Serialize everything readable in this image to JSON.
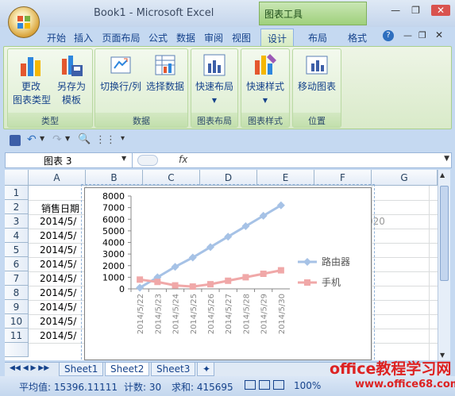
{
  "window": {
    "title": "Book1 - Microsoft Excel",
    "context_tab": "图表工具"
  },
  "tabs": [
    "开始",
    "插入",
    "页面布局",
    "公式",
    "数据",
    "审阅",
    "视图",
    "设计",
    "布局",
    "格式"
  ],
  "ribbon": {
    "groups": [
      {
        "label": "类型",
        "buttons": [
          "更改\n图表类型",
          "另存为\n模板"
        ]
      },
      {
        "label": "数据",
        "buttons": [
          "切换行/列",
          "选择数据"
        ]
      },
      {
        "label": "图表布局",
        "buttons": [
          "快速布局"
        ]
      },
      {
        "label": "图表样式",
        "buttons": [
          "快速样式"
        ]
      },
      {
        "label": "位置",
        "buttons": [
          "移动图表"
        ]
      }
    ]
  },
  "formula_bar": {
    "name_box": "图表 3",
    "fx": "fx",
    "value": ""
  },
  "columns": [
    "A",
    "B",
    "C",
    "D",
    "E",
    "F",
    "G"
  ],
  "rows": [
    "1",
    "2",
    "3",
    "4",
    "5",
    "6",
    "7",
    "8",
    "9",
    "10",
    "11"
  ],
  "cells": {
    "A2": "销售日期",
    "A3": "2014/5/",
    "A4": "2014/5/",
    "A5": "2014/5/",
    "A6": "2014/5/",
    "A7": "2014/5/",
    "A8": "2014/5/",
    "A9": "2014/5/",
    "A10": "2014/5/",
    "A11": "2014/5/",
    "F3": "020"
  },
  "chart_data": {
    "type": "line",
    "x": [
      "2014/5/22",
      "2014/5/23",
      "2014/5/24",
      "2014/5/25",
      "2014/5/26",
      "2014/5/27",
      "2014/5/28",
      "2014/5/29",
      "2014/5/30"
    ],
    "series": [
      {
        "name": "路由器",
        "values": [
          100,
          1000,
          1900,
          2700,
          3600,
          4500,
          5400,
          6300,
          7200
        ],
        "color": "#a6c2e6"
      },
      {
        "name": "手机",
        "values": [
          800,
          600,
          300,
          200,
          400,
          700,
          1000,
          1300,
          1600
        ],
        "color": "#f0a8a8"
      }
    ],
    "yticks": [
      "0",
      "1000",
      "2000",
      "3000",
      "4000",
      "5000",
      "6000",
      "7000",
      "8000"
    ],
    "ylim": [
      0,
      8000
    ]
  },
  "sheets": [
    "Sheet1",
    "Sheet2",
    "Sheet3"
  ],
  "active_sheet": "Sheet2",
  "status": {
    "average": "平均值: 15396.11111",
    "count": "计数: 30",
    "sum": "求和: 415695",
    "zoom": "100%"
  },
  "watermark": {
    "line1": "office教程学习网",
    "line2": "www.office68.com"
  }
}
